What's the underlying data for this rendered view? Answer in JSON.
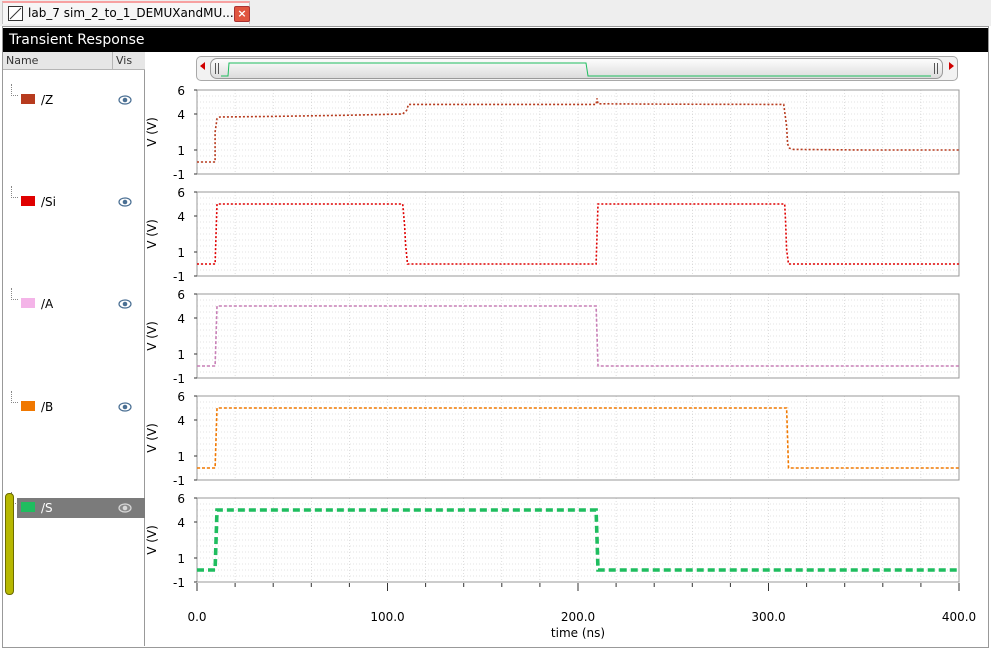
{
  "tab": {
    "title": "lab_7 sim_2_to_1_DEMUXandMU...",
    "close": "×"
  },
  "window": {
    "title": "Transient Response"
  },
  "sidebar": {
    "headers": {
      "name": "Name",
      "vis": "Vis"
    },
    "signals": [
      {
        "label": "/Z",
        "color": "#b73b1e",
        "icon": "eye-icon"
      },
      {
        "label": "/Si",
        "color": "#e00000",
        "icon": "eye-icon"
      },
      {
        "label": "/A",
        "color": "#f4b4e8",
        "icon": "eye-icon"
      },
      {
        "label": "/B",
        "color": "#f07800",
        "icon": "eye-icon"
      },
      {
        "label": "/S",
        "color": "#1fbd5f",
        "icon": "eye-icon",
        "selected": true
      }
    ]
  },
  "chart_data": {
    "type": "line",
    "xlabel": "time (ns)",
    "xlim": [
      0,
      400
    ],
    "xticks": [
      "0.0",
      "100.0",
      "200.0",
      "300.0",
      "400.0"
    ],
    "grid": true,
    "subplots": [
      {
        "name": "/Z",
        "ylabel": "V (V)",
        "ylim": [
          -1,
          6
        ],
        "yticks": [
          "6",
          "4",
          "1",
          "-1"
        ],
        "color": "#b73b1e",
        "style": "dotted",
        "x": [
          0,
          9.5,
          9.5,
          10.5,
          11,
          12,
          40,
          80,
          108,
          110,
          111,
          150,
          200,
          209.5,
          210,
          210.5,
          250,
          300,
          308,
          309.5,
          310,
          311,
          313,
          350,
          400
        ],
        "y": [
          0,
          0,
          2.5,
          3.6,
          3.7,
          3.75,
          3.8,
          3.9,
          4.0,
          4.3,
          4.8,
          4.8,
          4.8,
          4.8,
          5.3,
          4.85,
          4.82,
          4.8,
          4.8,
          3.0,
          1.5,
          1.15,
          1.05,
          1.0,
          1.0
        ]
      },
      {
        "name": "/Si",
        "ylabel": "V (V)",
        "ylim": [
          -1,
          6
        ],
        "yticks": [
          "6",
          "4",
          "1",
          "-1"
        ],
        "color": "#e00000",
        "style": "dotted",
        "x": [
          0,
          9.5,
          10.5,
          108,
          109,
          109.5,
          110.5,
          209.5,
          210.5,
          308.5,
          309,
          309.5,
          310.5,
          400
        ],
        "y": [
          0,
          0,
          5,
          5,
          3.2,
          1.6,
          0,
          0,
          5,
          5,
          3.5,
          1.2,
          0,
          0
        ]
      },
      {
        "name": "/A",
        "ylabel": "V (V)",
        "ylim": [
          -1,
          6
        ],
        "yticks": [
          "6",
          "4",
          "1",
          "-1"
        ],
        "color": "#c77fb6",
        "style": "dashed",
        "x": [
          0,
          9.5,
          10.5,
          209.5,
          210.5,
          400
        ],
        "y": [
          0,
          0,
          5,
          5,
          0,
          0
        ]
      },
      {
        "name": "/B",
        "ylabel": "V (V)",
        "ylim": [
          -1,
          6
        ],
        "yticks": [
          "6",
          "4",
          "1",
          "-1"
        ],
        "color": "#f07800",
        "style": "dashed",
        "x": [
          0,
          9.5,
          10.5,
          309.5,
          310.5,
          400
        ],
        "y": [
          0,
          0,
          5,
          5,
          0,
          0
        ]
      },
      {
        "name": "/S",
        "ylabel": "V (V)",
        "ylim": [
          -1,
          6
        ],
        "yticks": [
          "6",
          "4",
          "1",
          "-1"
        ],
        "color": "#1fbd5f",
        "style": "thick-dashed",
        "x": [
          0,
          9.5,
          10.5,
          209.5,
          210.5,
          400
        ],
        "y": [
          0,
          0,
          5,
          5,
          0,
          0
        ]
      }
    ]
  }
}
